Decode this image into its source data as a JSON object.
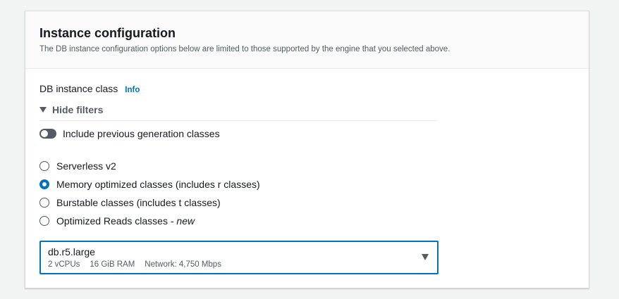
{
  "panel": {
    "title": "Instance configuration",
    "subtitle": "The DB instance configuration options below are limited to those supported by the engine that you selected above."
  },
  "field": {
    "label": "DB instance class",
    "info": "Info"
  },
  "filters": {
    "toggle_label": "Hide filters",
    "previous_gen_label": "Include previous generation classes",
    "previous_gen_enabled": false
  },
  "radios": [
    {
      "label": "Serverless v2",
      "suffix": "",
      "selected": false
    },
    {
      "label": "Memory optimized classes (includes r classes)",
      "suffix": "",
      "selected": true
    },
    {
      "label": "Burstable classes (includes t classes)",
      "suffix": "",
      "selected": false
    },
    {
      "label": "Optimized Reads classes - ",
      "suffix": "new",
      "selected": false
    }
  ],
  "select": {
    "value": "db.r5.large",
    "vcpus": "2 vCPUs",
    "ram": "16 GiB RAM",
    "network": "Network: 4,750 Mbps"
  },
  "colors": {
    "accent": "#0073bb",
    "background": "#f2f3f3"
  }
}
